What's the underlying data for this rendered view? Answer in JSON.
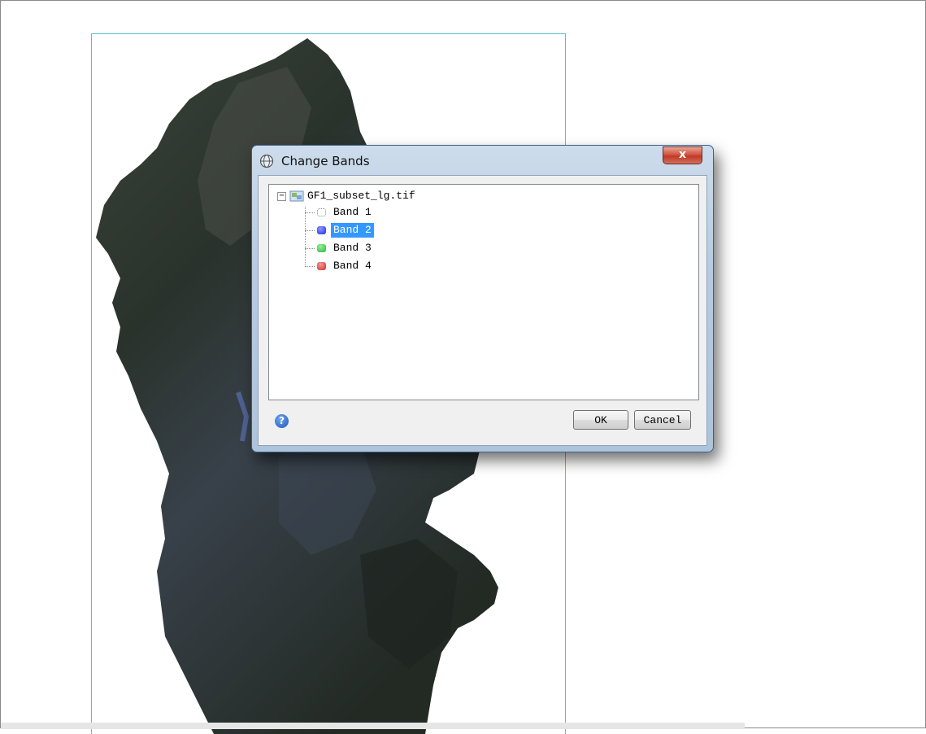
{
  "dialog": {
    "title": "Change Bands",
    "close_glyph": "x",
    "title_icon": "globe-icon",
    "tree": {
      "root": {
        "label": "GF1_subset_lg.tif",
        "expander": "−",
        "icon": "raster-file-icon"
      },
      "bands": [
        {
          "label": "Band 1",
          "color": "",
          "selected": false
        },
        {
          "label": "Band 2",
          "color": "#1d2fd6",
          "selected": true
        },
        {
          "label": "Band 3",
          "color": "#1fb83a",
          "selected": false
        },
        {
          "label": "Band 4",
          "color": "#d62a2a",
          "selected": false
        }
      ]
    },
    "help_glyph": "?",
    "ok_label": "OK",
    "cancel_label": "Cancel"
  },
  "colors": {
    "selection": "#3399ff",
    "map_frame": "#4fc3d0",
    "titlebar": "#b6cbe1"
  }
}
